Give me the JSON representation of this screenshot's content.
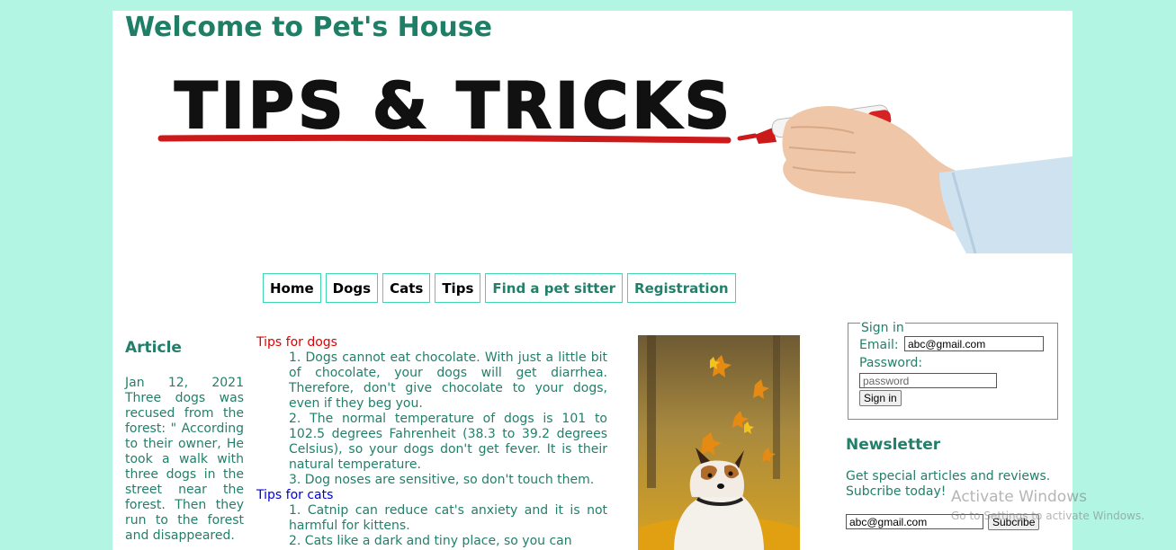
{
  "site": {
    "title": "Welcome to Pet's House",
    "banner_text": "TIPS & TRICKS"
  },
  "nav": {
    "items": [
      {
        "label": "Home"
      },
      {
        "label": "Dogs"
      },
      {
        "label": "Cats"
      },
      {
        "label": "Tips"
      },
      {
        "label": "Find a pet sitter"
      },
      {
        "label": "Registration"
      }
    ]
  },
  "article": {
    "heading": "Article",
    "body": "Jan 12, 2021 Three dogs was recused from the forest: \" According to their owner, He took a walk with three dogs in the street near the forest. Then they run to the forest and disappeared."
  },
  "tips": {
    "dogs_heading": "Tips for dogs",
    "dogs": [
      "1. Dogs cannot eat chocolate. With just a little bit of chocolate, your dogs will get diarrhea. Therefore, don't give chocolate to your dogs, even if they beg you.",
      "2. The normal temperature of dogs is 101 to 102.5 degrees Fahrenheit (38.3 to 39.2 degrees Celsius), so your dogs don't get fever. It is their natural temperature.",
      "3. Dog noses are sensitive, so don't touch them."
    ],
    "cats_heading": "Tips for cats",
    "cats": [
      "1. Catnip can reduce cat's anxiety and it is not harmful for kittens.",
      "2. Cats like a dark and tiny place, so you can"
    ]
  },
  "signin": {
    "legend": "Sign in",
    "email_label": "Email:",
    "email_value": "abc@gmail.com",
    "password_label": "Password:",
    "password_placeholder": "password",
    "button_label": "Sign in"
  },
  "newsletter": {
    "heading": "Newsletter",
    "text": "Get special articles and reviews. Subcribe today!",
    "email_value": "abc@gmail.com",
    "button_label": "Subcribe"
  },
  "watermark": {
    "line1": "Activate Windows",
    "line2": "Go to Settings to activate Windows."
  },
  "colors": {
    "background": "#b3f5e3",
    "text_green": "#227f6a",
    "nav_border": "#40d6b0",
    "dogs_heading": "#e00000",
    "cats_heading": "#0000dd"
  }
}
